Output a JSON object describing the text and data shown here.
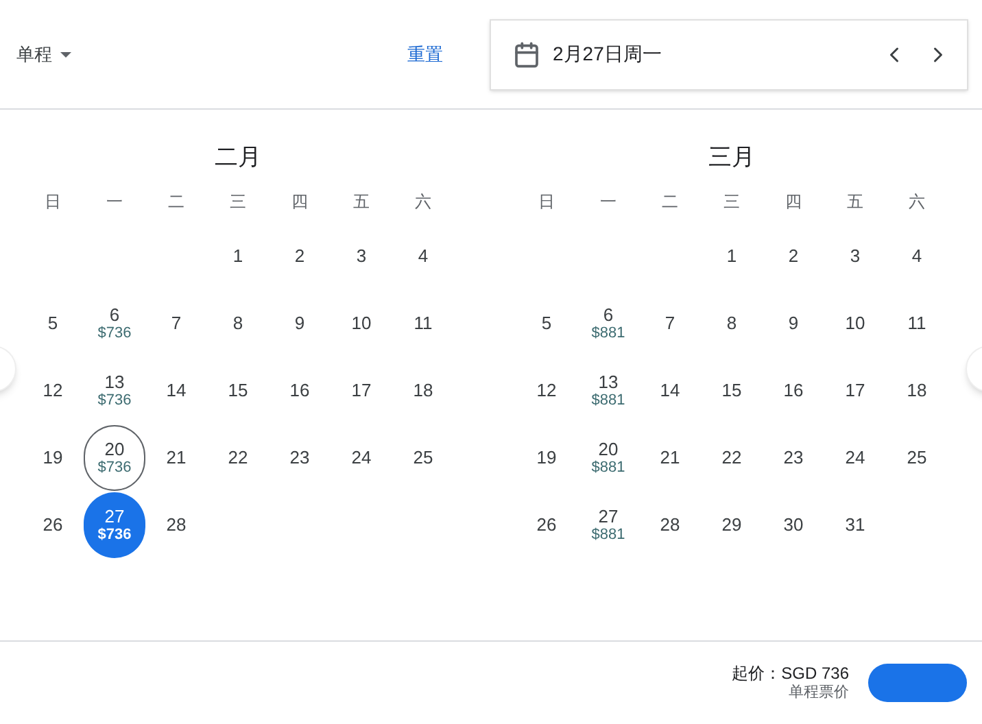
{
  "trip_type": {
    "label": "单程"
  },
  "reset": {
    "label": "重置"
  },
  "date_field": {
    "value": "2月27日周一"
  },
  "months": [
    {
      "title": "二月",
      "weekdays": [
        "日",
        "一",
        "二",
        "三",
        "四",
        "五",
        "六"
      ],
      "weeks": [
        [
          {
            "kind": "empty"
          },
          {
            "kind": "empty"
          },
          {
            "kind": "empty"
          },
          {
            "kind": "day",
            "day": "1",
            "selected": false,
            "outlined": false
          },
          {
            "kind": "day",
            "day": "2",
            "selected": false,
            "outlined": false
          },
          {
            "kind": "day",
            "day": "3",
            "selected": false,
            "outlined": false
          },
          {
            "kind": "day",
            "day": "4",
            "selected": false,
            "outlined": false
          }
        ],
        [
          {
            "kind": "day",
            "day": "5",
            "selected": false,
            "outlined": false
          },
          {
            "kind": "day",
            "day": "6",
            "price": "$736",
            "selected": false,
            "outlined": false
          },
          {
            "kind": "day",
            "day": "7",
            "selected": false,
            "outlined": false
          },
          {
            "kind": "day",
            "day": "8",
            "selected": false,
            "outlined": false
          },
          {
            "kind": "day",
            "day": "9",
            "selected": false,
            "outlined": false
          },
          {
            "kind": "day",
            "day": "10",
            "selected": false,
            "outlined": false
          },
          {
            "kind": "day",
            "day": "11",
            "selected": false,
            "outlined": false
          }
        ],
        [
          {
            "kind": "day",
            "day": "12",
            "selected": false,
            "outlined": false
          },
          {
            "kind": "day",
            "day": "13",
            "price": "$736",
            "selected": false,
            "outlined": false
          },
          {
            "kind": "day",
            "day": "14",
            "selected": false,
            "outlined": false
          },
          {
            "kind": "day",
            "day": "15",
            "selected": false,
            "outlined": false
          },
          {
            "kind": "day",
            "day": "16",
            "selected": false,
            "outlined": false
          },
          {
            "kind": "day",
            "day": "17",
            "selected": false,
            "outlined": false
          },
          {
            "kind": "day",
            "day": "18",
            "selected": false,
            "outlined": false
          }
        ],
        [
          {
            "kind": "day",
            "day": "19",
            "selected": false,
            "outlined": false
          },
          {
            "kind": "day",
            "day": "20",
            "price": "$736",
            "selected": false,
            "outlined": true
          },
          {
            "kind": "day",
            "day": "21",
            "selected": false,
            "outlined": false
          },
          {
            "kind": "day",
            "day": "22",
            "selected": false,
            "outlined": false
          },
          {
            "kind": "day",
            "day": "23",
            "selected": false,
            "outlined": false
          },
          {
            "kind": "day",
            "day": "24",
            "selected": false,
            "outlined": false
          },
          {
            "kind": "day",
            "day": "25",
            "selected": false,
            "outlined": false
          }
        ],
        [
          {
            "kind": "day",
            "day": "26",
            "selected": false,
            "outlined": false
          },
          {
            "kind": "day",
            "day": "27",
            "price": "$736",
            "selected": true,
            "outlined": false
          },
          {
            "kind": "day",
            "day": "28",
            "selected": false,
            "outlined": false
          }
        ]
      ]
    },
    {
      "title": "三月",
      "weekdays": [
        "日",
        "一",
        "二",
        "三",
        "四",
        "五",
        "六"
      ],
      "weeks": [
        [
          {
            "kind": "empty"
          },
          {
            "kind": "empty"
          },
          {
            "kind": "empty"
          },
          {
            "kind": "day",
            "day": "1",
            "selected": false,
            "outlined": false
          },
          {
            "kind": "day",
            "day": "2",
            "selected": false,
            "outlined": false
          },
          {
            "kind": "day",
            "day": "3",
            "selected": false,
            "outlined": false
          },
          {
            "kind": "day",
            "day": "4",
            "selected": false,
            "outlined": false
          }
        ],
        [
          {
            "kind": "day",
            "day": "5",
            "selected": false,
            "outlined": false
          },
          {
            "kind": "day",
            "day": "6",
            "price": "$881",
            "selected": false,
            "outlined": false
          },
          {
            "kind": "day",
            "day": "7",
            "selected": false,
            "outlined": false
          },
          {
            "kind": "day",
            "day": "8",
            "selected": false,
            "outlined": false
          },
          {
            "kind": "day",
            "day": "9",
            "selected": false,
            "outlined": false
          },
          {
            "kind": "day",
            "day": "10",
            "selected": false,
            "outlined": false
          },
          {
            "kind": "day",
            "day": "11",
            "selected": false,
            "outlined": false
          }
        ],
        [
          {
            "kind": "day",
            "day": "12",
            "selected": false,
            "outlined": false
          },
          {
            "kind": "day",
            "day": "13",
            "price": "$881",
            "selected": false,
            "outlined": false
          },
          {
            "kind": "day",
            "day": "14",
            "selected": false,
            "outlined": false
          },
          {
            "kind": "day",
            "day": "15",
            "selected": false,
            "outlined": false
          },
          {
            "kind": "day",
            "day": "16",
            "selected": false,
            "outlined": false
          },
          {
            "kind": "day",
            "day": "17",
            "selected": false,
            "outlined": false
          },
          {
            "kind": "day",
            "day": "18",
            "selected": false,
            "outlined": false
          }
        ],
        [
          {
            "kind": "day",
            "day": "19",
            "selected": false,
            "outlined": false
          },
          {
            "kind": "day",
            "day": "20",
            "price": "$881",
            "selected": false,
            "outlined": false
          },
          {
            "kind": "day",
            "day": "21",
            "selected": false,
            "outlined": false
          },
          {
            "kind": "day",
            "day": "22",
            "selected": false,
            "outlined": false
          },
          {
            "kind": "day",
            "day": "23",
            "selected": false,
            "outlined": false
          },
          {
            "kind": "day",
            "day": "24",
            "selected": false,
            "outlined": false
          },
          {
            "kind": "day",
            "day": "25",
            "selected": false,
            "outlined": false
          }
        ],
        [
          {
            "kind": "day",
            "day": "26",
            "selected": false,
            "outlined": false
          },
          {
            "kind": "day",
            "day": "27",
            "price": "$881",
            "selected": false,
            "outlined": false
          },
          {
            "kind": "day",
            "day": "28",
            "selected": false,
            "outlined": false
          },
          {
            "kind": "day",
            "day": "29",
            "selected": false,
            "outlined": false
          },
          {
            "kind": "day",
            "day": "30",
            "selected": false,
            "outlined": false
          },
          {
            "kind": "day",
            "day": "31",
            "selected": false,
            "outlined": false
          }
        ]
      ]
    }
  ],
  "footer": {
    "starting_price": "起价：SGD 736",
    "price_note": "单程票价"
  }
}
